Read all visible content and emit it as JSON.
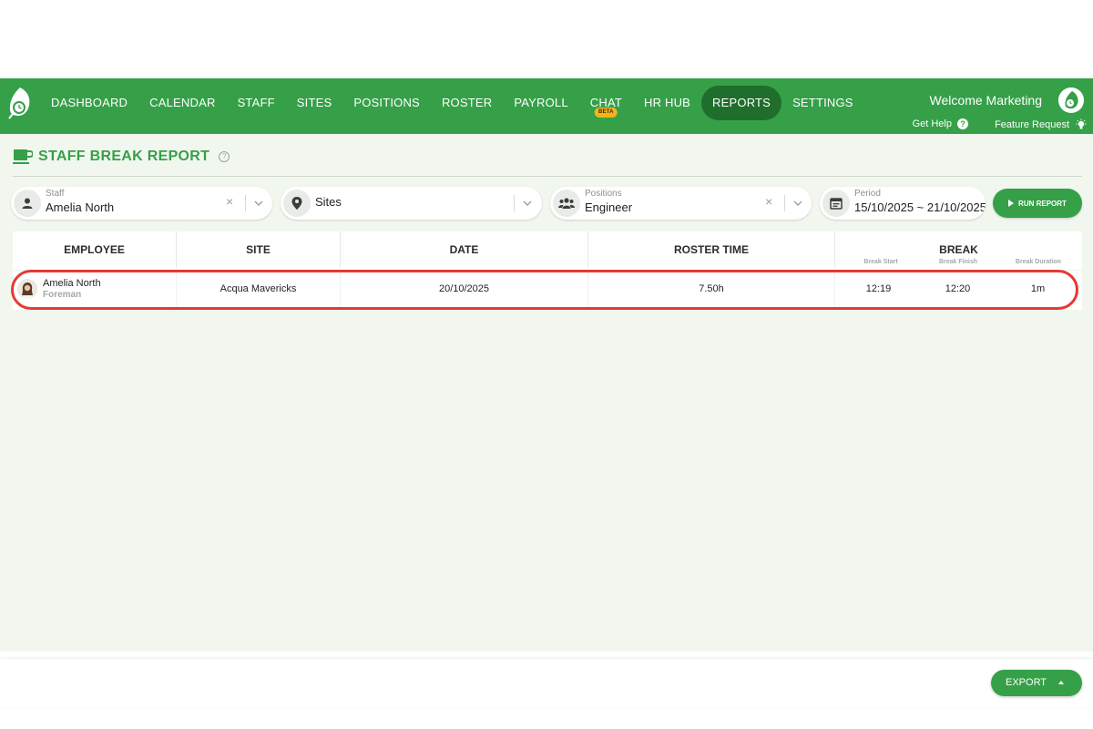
{
  "nav": {
    "items": [
      {
        "label": "DASHBOARD"
      },
      {
        "label": "CALENDAR"
      },
      {
        "label": "STAFF"
      },
      {
        "label": "SITES"
      },
      {
        "label": "POSITIONS"
      },
      {
        "label": "ROSTER"
      },
      {
        "label": "PAYROLL"
      },
      {
        "label": "CHAT",
        "badge": "BETA"
      },
      {
        "label": "HR HUB"
      },
      {
        "label": "REPORTS",
        "active": true
      },
      {
        "label": "SETTINGS"
      }
    ],
    "welcome": "Welcome Marketing",
    "get_help": "Get Help",
    "feature_request": "Feature Request"
  },
  "page": {
    "title": "STAFF BREAK REPORT"
  },
  "filters": {
    "staff": {
      "label": "Staff",
      "value": "Amelia North"
    },
    "sites": {
      "value": "Sites"
    },
    "positions": {
      "label": "Positions",
      "value": "Engineer"
    },
    "period": {
      "label": "Period",
      "value": "15/10/2025 ~ 21/10/2025"
    },
    "run_button": "RUN REPORT"
  },
  "table": {
    "headers": {
      "employee": "EMPLOYEE",
      "site": "SITE",
      "date": "DATE",
      "roster_time": "ROSTER TIME",
      "break": "BREAK",
      "break_start": "Break Start",
      "break_finish": "Break Finish",
      "break_duration": "Break Duration"
    },
    "rows": [
      {
        "name": "Amelia North",
        "position": "Foreman",
        "site": "Acqua Mavericks",
        "date": "20/10/2025",
        "roster_time": "7.50h",
        "break_start": "12:19",
        "break_finish": "12:20",
        "break_duration": "1m"
      }
    ]
  },
  "footer": {
    "export_label": "EXPORT"
  },
  "colors": {
    "brand_green": "#35a048",
    "active_nav": "#1f6e2b",
    "highlight": "#e53935",
    "beta_badge": "#f4b41a"
  }
}
